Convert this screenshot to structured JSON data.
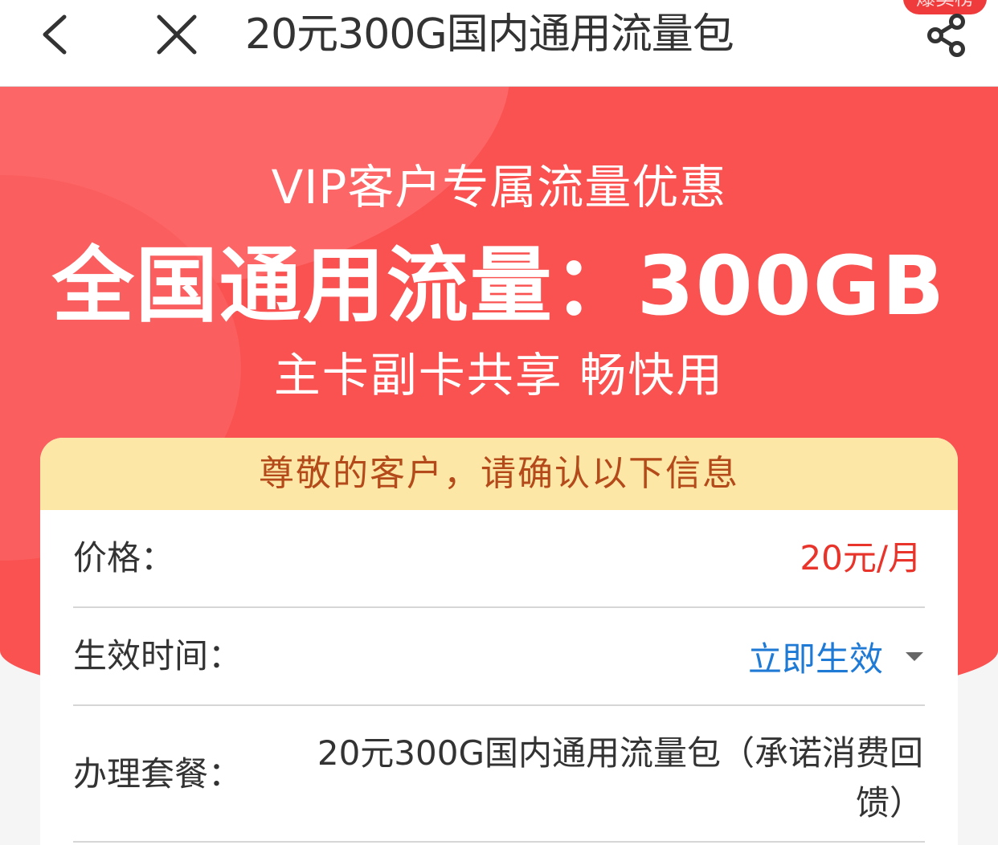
{
  "nav": {
    "title": "20元300G国内通用流量包",
    "hot_badge": "爆卖榜"
  },
  "hero": {
    "subtitle": "VIP客户专属流量优惠",
    "headline": "全国通用流量：300GB",
    "tagline": "主卡副卡共享 畅快用"
  },
  "card": {
    "header": "尊敬的客户，请确认以下信息",
    "price_label": "价格：",
    "price_value": "20元/月",
    "effective_label": "生效时间：",
    "effective_value": "立即生效",
    "plan_label": "办理套餐：",
    "plan_value": "20元300G国内通用流量包（承诺消费回馈）"
  },
  "colors": {
    "hero_red": "#fa5151",
    "price_red": "#e8342a",
    "link_blue": "#1f7ad6",
    "header_yellow": "#fde7a7"
  },
  "icons": {
    "back": "chevron-left-icon",
    "close": "close-icon",
    "share": "share-icon"
  }
}
